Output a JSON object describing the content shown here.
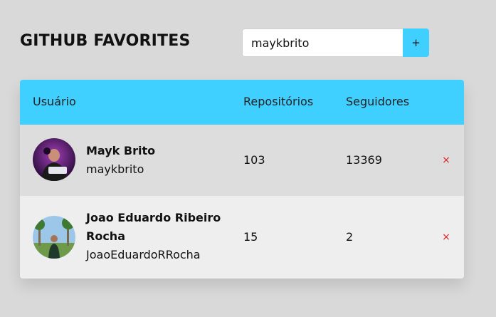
{
  "app": {
    "title": "GITHUB FAVORITES"
  },
  "search": {
    "value": "maykbrito",
    "add_label": "+"
  },
  "table": {
    "headers": {
      "user": "Usuário",
      "repos": "Repositórios",
      "followers": "Seguidores"
    },
    "rows": [
      {
        "name": "Mayk Brito",
        "login": "maykbrito",
        "repos": "103",
        "followers": "13369",
        "remove_label": "×"
      },
      {
        "name": "Joao Eduardo Ribeiro Rocha",
        "login": "JoaoEduardoRRocha",
        "repos": "15",
        "followers": "2",
        "remove_label": "×"
      }
    ]
  },
  "colors": {
    "accent": "#40d0ff",
    "background": "#d9d9d9",
    "remove": "#e02020"
  }
}
